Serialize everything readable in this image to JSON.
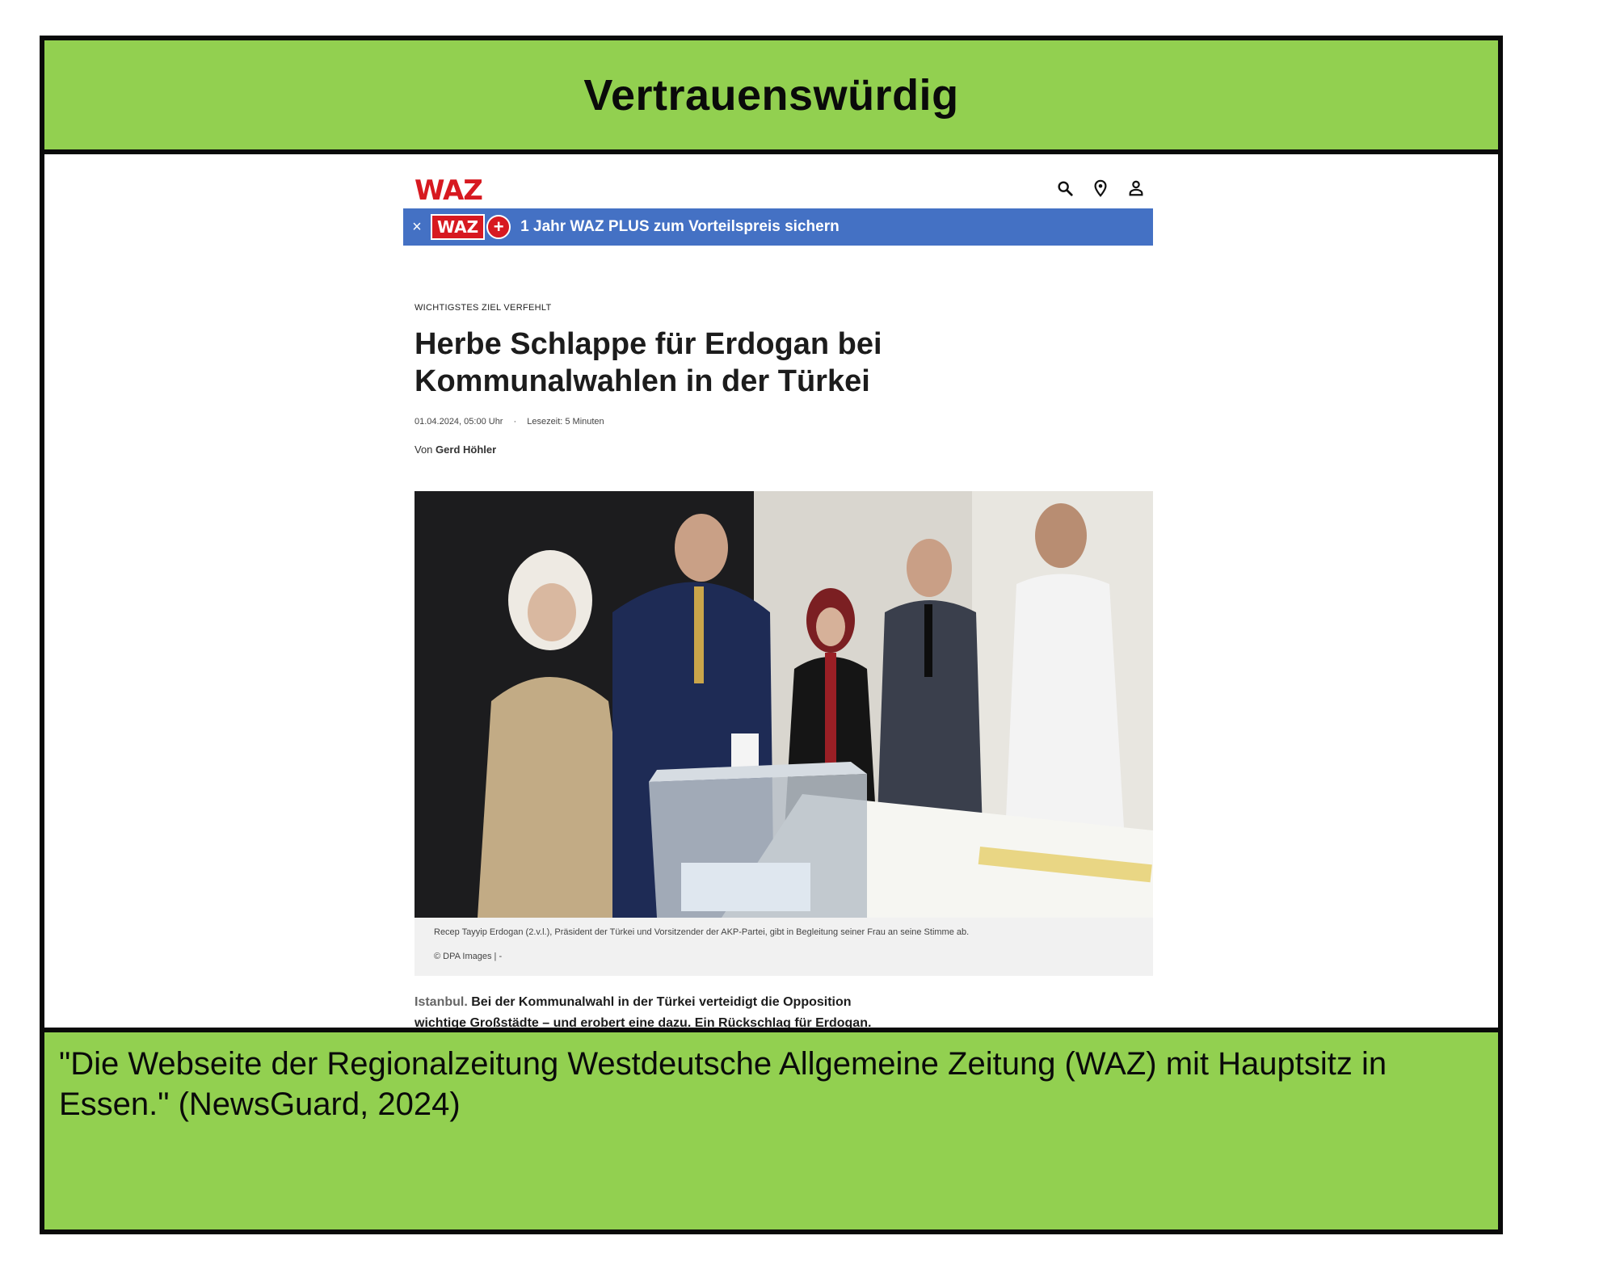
{
  "top_label": "Vertrauenswürdig",
  "site": {
    "logo": "WAZ",
    "header_icons": [
      "search-icon",
      "location-pin-icon",
      "user-icon"
    ],
    "promo": {
      "close": "×",
      "logo": "WAZ",
      "plus": "+",
      "text": "1 Jahr WAZ PLUS zum Vorteilspreis sichern"
    },
    "article": {
      "kicker": "Wichtigstes Ziel verfehlt",
      "headline": "Herbe Schlappe für Erdogan bei Kommunalwahlen in der Türkei",
      "date": "01.04.2024, 05:00 Uhr",
      "separator": "·",
      "reading_time": "Lesezeit: 5 Minuten",
      "author_prefix": "Von",
      "author": "Gerd Höhler",
      "caption": "Recep Tayyip Erdogan (2.v.l.), Präsident der Türkei und Vorsitzender der AKP-Partei, gibt in Begleitung seiner Frau an seine Stimme ab.",
      "credit": "© DPA Images | -",
      "lead_place": "Istanbul.",
      "lead_text": "Bei der Kommunalwahl in der Türkei verteidigt die Opposition wichtige Großstädte – und erobert eine dazu. Ein Rückschlag für Erdogan."
    },
    "colors": {
      "brand_red": "#d71920",
      "promo_blue": "#4471c4"
    }
  },
  "bottom_text": "\"Die Webseite der Regionalzeitung Westdeutsche Allgemeine Zeitung (WAZ) mit Hauptsitz in Essen.\" (NewsGuard, 2024)",
  "theme": {
    "band_green": "#92d050",
    "border": "#0a0a0a"
  }
}
